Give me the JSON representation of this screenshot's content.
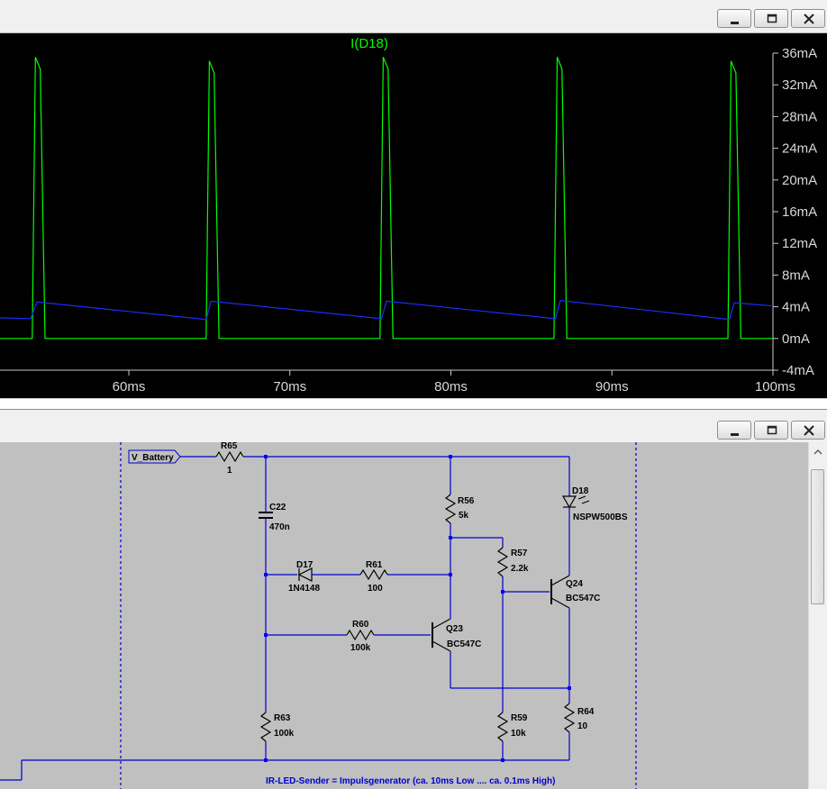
{
  "plot_window": {
    "trace_name": "I(D18)",
    "colors": {
      "background": "#000000",
      "trace_current": "#00ff00",
      "trace_second": "#1a2fff",
      "axis": "#c8c8c8"
    },
    "controls": {
      "minimize_icon": "minimize-icon",
      "restore_icon": "restore-icon",
      "close_icon": "close-icon"
    }
  },
  "chart_data": {
    "type": "line",
    "title": "I(D18)",
    "xlabel": "",
    "ylabel": "",
    "x_ticks": [
      "60ms",
      "70ms",
      "80ms",
      "90ms",
      "100ms"
    ],
    "y_ticks": [
      "36mA",
      "32mA",
      "28mA",
      "24mA",
      "20mA",
      "16mA",
      "12mA",
      "8mA",
      "4mA",
      "0mA",
      "-4mA"
    ],
    "xlim": [
      52,
      100
    ],
    "ylim": [
      -4,
      36
    ],
    "grid": false,
    "series": [
      {
        "name": "I(D18)",
        "color": "#00ff00",
        "x": [
          52,
          54.0,
          54.2,
          54.5,
          54.8,
          64.8,
          65.0,
          65.3,
          65.6,
          75.6,
          75.8,
          76.1,
          76.4,
          86.4,
          86.6,
          86.9,
          87.2,
          97.2,
          97.4,
          97.7,
          98.0,
          100
        ],
        "y": [
          0,
          0,
          35.5,
          34,
          0,
          0,
          35,
          33.5,
          0,
          0,
          35.5,
          34,
          0,
          0,
          35.5,
          34,
          0,
          0,
          35,
          33.5,
          0,
          0
        ]
      },
      {
        "color": "#1a2fff",
        "x": [
          52,
          53.9,
          54.3,
          64.8,
          65.1,
          75.7,
          76.0,
          86.5,
          86.8,
          97.3,
          97.6,
          100
        ],
        "y": [
          2.6,
          2.5,
          4.6,
          2.4,
          4.7,
          2.5,
          4.7,
          2.5,
          4.8,
          2.4,
          4.5,
          4.1
        ]
      }
    ]
  },
  "schematic": {
    "annotation": "IR-LED-Sender = Impulsgenerator  (ca. 10ms Low ....  ca. 0.1ms High)",
    "net_label": "V_Battery",
    "components": {
      "R65": {
        "name": "R65",
        "value": "1"
      },
      "C22": {
        "name": "C22",
        "value": "470n"
      },
      "R56": {
        "name": "R56",
        "value": "5k"
      },
      "D18": {
        "name": "D18",
        "value": "NSPW500BS"
      },
      "R57": {
        "name": "R57",
        "value": "2.2k"
      },
      "Q24": {
        "name": "Q24",
        "value": "BC547C"
      },
      "D17": {
        "name": "D17",
        "value": "1N4148"
      },
      "R61": {
        "name": "R61",
        "value": "100"
      },
      "R60": {
        "name": "R60",
        "value": "100k"
      },
      "Q23": {
        "name": "Q23",
        "value": "BC547C"
      },
      "R63": {
        "name": "R63",
        "value": "100k"
      },
      "R59": {
        "name": "R59",
        "value": "10k"
      },
      "R64": {
        "name": "R64",
        "value": "10"
      }
    },
    "colors": {
      "background": "#c0c0c0",
      "wire": "#0000cc",
      "text": "#000000",
      "junction": "#0000ff"
    }
  }
}
